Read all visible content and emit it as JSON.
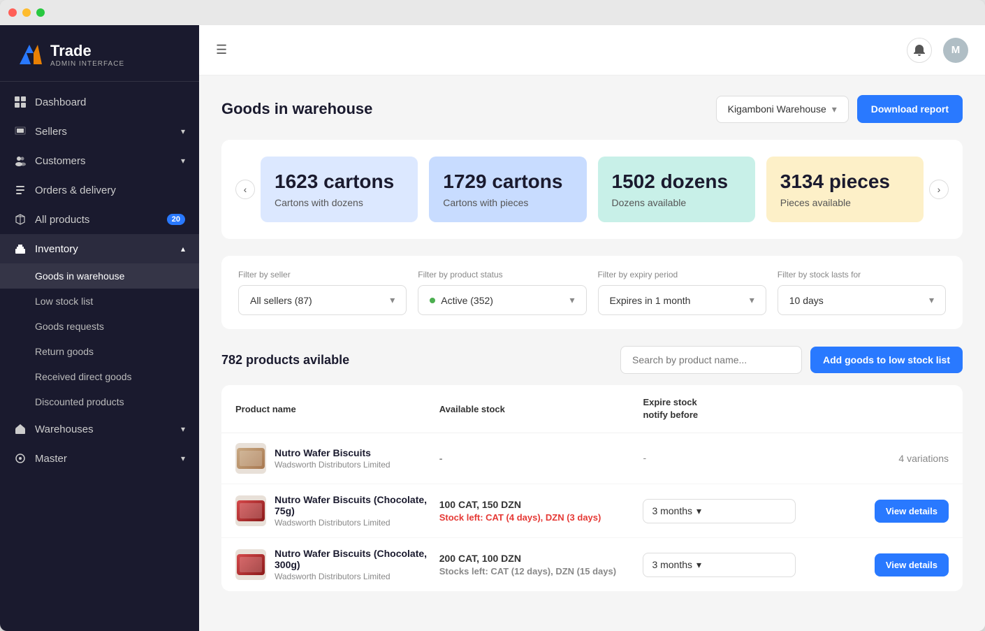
{
  "titlebar": {
    "dots": [
      "red",
      "yellow",
      "green"
    ]
  },
  "sidebar": {
    "logo": {
      "name": "Trade",
      "sub": "ADMIN INTERFACE"
    },
    "nav_items": [
      {
        "id": "dashboard",
        "label": "Dashboard",
        "icon": "grid",
        "active": false
      },
      {
        "id": "sellers",
        "label": "Sellers",
        "icon": "store",
        "has_chevron": true,
        "active": false
      },
      {
        "id": "customers",
        "label": "Customers",
        "icon": "people",
        "has_chevron": true,
        "active": false
      },
      {
        "id": "orders",
        "label": "Orders & delivery",
        "icon": "list",
        "active": false
      },
      {
        "id": "products",
        "label": "All products",
        "icon": "box",
        "badge": "20",
        "active": false
      },
      {
        "id": "inventory",
        "label": "Inventory",
        "icon": "warehouse",
        "has_chevron": true,
        "expanded": true,
        "active": false
      }
    ],
    "inventory_sub": [
      {
        "id": "goods-in-warehouse",
        "label": "Goods in warehouse",
        "active": true
      },
      {
        "id": "low-stock-list",
        "label": "Low stock list",
        "active": false
      },
      {
        "id": "goods-requests",
        "label": "Goods requests",
        "active": false
      },
      {
        "id": "return-goods",
        "label": "Return goods",
        "active": false
      },
      {
        "id": "received-direct-goods",
        "label": "Received direct goods",
        "active": false
      },
      {
        "id": "discounted-products",
        "label": "Discounted products",
        "active": false
      }
    ],
    "warehouses": {
      "label": "Warehouses",
      "has_chevron": true
    },
    "master": {
      "label": "Master",
      "has_chevron": true
    }
  },
  "header": {
    "hamburger_icon": "☰",
    "bell_icon": "🔔",
    "avatar_initial": "M"
  },
  "page": {
    "title": "Goods in warehouse",
    "warehouse_select": "Kigamboni Warehouse",
    "download_btn": "Download report"
  },
  "stats": {
    "cards": [
      {
        "number": "1623 cartons",
        "label": "Cartons with dozens",
        "color": "blue-light"
      },
      {
        "number": "1729 cartons",
        "label": "Cartons with pieces",
        "color": "blue-med"
      },
      {
        "number": "1502 dozens",
        "label": "Dozens available",
        "color": "teal"
      },
      {
        "number": "3134 pieces",
        "label": "Pieces available",
        "color": "yellow"
      }
    ]
  },
  "filters": {
    "seller_label": "Filter by seller",
    "seller_value": "All sellers (87)",
    "status_label": "Filter by product status",
    "status_value": "Active (352)",
    "expiry_label": "Filter by expiry period",
    "expiry_value": "Expires in 1 month",
    "stock_label": "Filter by stock lasts for",
    "stock_value": "10 days"
  },
  "products_section": {
    "title": "782 products avilable",
    "search_placeholder": "Search by product name...",
    "add_btn": "Add goods to low stock list"
  },
  "table": {
    "headers": {
      "product": "Product name",
      "stock": "Available stock",
      "expire": "Expire stock\nnotify before",
      "action": ""
    },
    "rows": [
      {
        "id": "row1",
        "name": "Nutro Wafer Biscuits",
        "seller": "Wadsworth Distributors Limited",
        "stock_main": "-",
        "stock_warning": "",
        "expire": "-",
        "action_type": "variations",
        "action_label": "4 variations"
      },
      {
        "id": "row2",
        "name": "Nutro Wafer Biscuits (Chocolate, 75g)",
        "seller": "Wadsworth Distributors Limited",
        "stock_main": "100 CAT, 150 DZN",
        "stock_warning": "Stock left: CAT (4 days), DZN (3 days)",
        "expire": "3 months",
        "action_type": "view",
        "action_label": "View details"
      },
      {
        "id": "row3",
        "name": "Nutro Wafer Biscuits (Chocolate, 300g)",
        "seller": "Wadsworth Distributors Limited",
        "stock_main": "200 CAT, 100 DZN",
        "stock_warning": "Stocks left: CAT (12 days), DZN (15 days)",
        "expire": "3 months",
        "action_type": "view",
        "action_label": "View details"
      }
    ]
  }
}
